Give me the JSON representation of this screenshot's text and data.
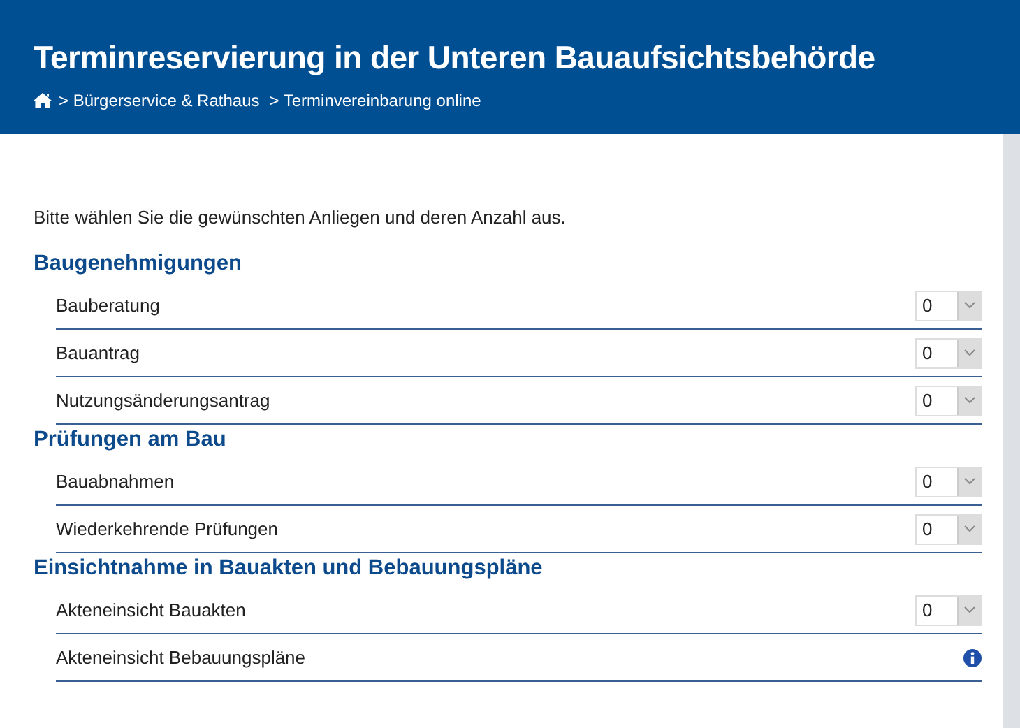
{
  "header": {
    "title": "Terminreservierung in der Unteren Bauaufsichtsbehörde",
    "breadcrumb": [
      "> Bürgerservice & Rathaus",
      "> Terminvereinbarung online"
    ]
  },
  "intro": "Bitte wählen Sie die gewünschten Anliegen und deren Anzahl aus.",
  "sections": [
    {
      "title": "Baugenehmigungen",
      "items": [
        {
          "kind": "select",
          "label": "Bauberatung",
          "value": "0"
        },
        {
          "kind": "select",
          "label": "Bauantrag",
          "value": "0"
        },
        {
          "kind": "select",
          "label": "Nutzungsänderungsantrag",
          "value": "0"
        }
      ]
    },
    {
      "title": "Prüfungen am Bau",
      "items": [
        {
          "kind": "select",
          "label": "Bauabnahmen",
          "value": "0"
        },
        {
          "kind": "select",
          "label": "Wiederkehrende Prüfungen",
          "value": "0"
        }
      ]
    },
    {
      "title": "Einsichtnahme in Bauakten und Bebauungspläne",
      "items": [
        {
          "kind": "select",
          "label": "Akteneinsicht Bauakten",
          "value": "0"
        },
        {
          "kind": "info",
          "label": "Akteneinsicht Bebauungspläne"
        }
      ]
    }
  ]
}
